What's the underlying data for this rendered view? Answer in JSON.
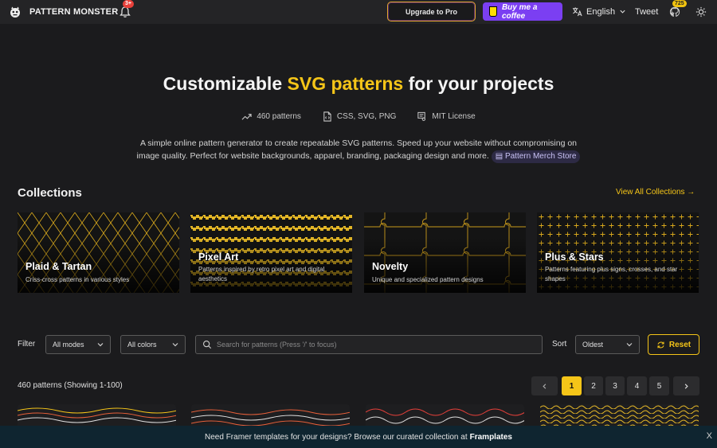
{
  "header": {
    "brand": "PATTERN MONSTER",
    "notif_badge": "3+",
    "upgrade_label": "Upgrade to Pro",
    "coffee_label": "Buy me a coffee",
    "language": "English",
    "tweet_label": "Tweet",
    "github_stars": "725"
  },
  "hero": {
    "title_pre": "Customizable ",
    "title_accent": "SVG patterns",
    "title_post": " for your projects",
    "stats": [
      "460 patterns",
      "CSS, SVG, PNG",
      "MIT License"
    ],
    "description": "A simple online pattern generator to create repeatable SVG patterns. Speed up your website without compromising on image quality. Perfect for website backgrounds, apparel, branding, packaging design and more.",
    "merch_label": "Pattern Merch Store"
  },
  "collections": {
    "title": "Collections",
    "view_all": "View All Collections →",
    "items": [
      {
        "title": "Plaid & Tartan",
        "subtitle": "Criss-cross patterns in various styles"
      },
      {
        "title": "Pixel Art",
        "subtitle": "Patterns inspired by retro pixel art and digital aesthetics"
      },
      {
        "title": "Novelty",
        "subtitle": "Unique and specialized pattern designs"
      },
      {
        "title": "Plus & Stars",
        "subtitle": "Patterns featuring plus signs, crosses, and star shapes"
      }
    ]
  },
  "filters": {
    "filter_label": "Filter",
    "mode_value": "All modes",
    "color_value": "All colors",
    "search_placeholder": "Search for patterns (Press '/' to focus)",
    "sort_label": "Sort",
    "sort_value": "Oldest",
    "reset_label": "Reset"
  },
  "pagination": {
    "count_text": "460 patterns (Showing 1-100)",
    "pages": [
      "1",
      "2",
      "3",
      "4",
      "5"
    ],
    "active_page": "1"
  },
  "banner": {
    "text": "Need Framer templates for your designs? Browse our curated collection at",
    "link": "Framplates",
    "close": "X"
  },
  "colors": {
    "accent": "#f5c518",
    "background": "#1b1b1d",
    "coffee": "#7b3ff2"
  }
}
